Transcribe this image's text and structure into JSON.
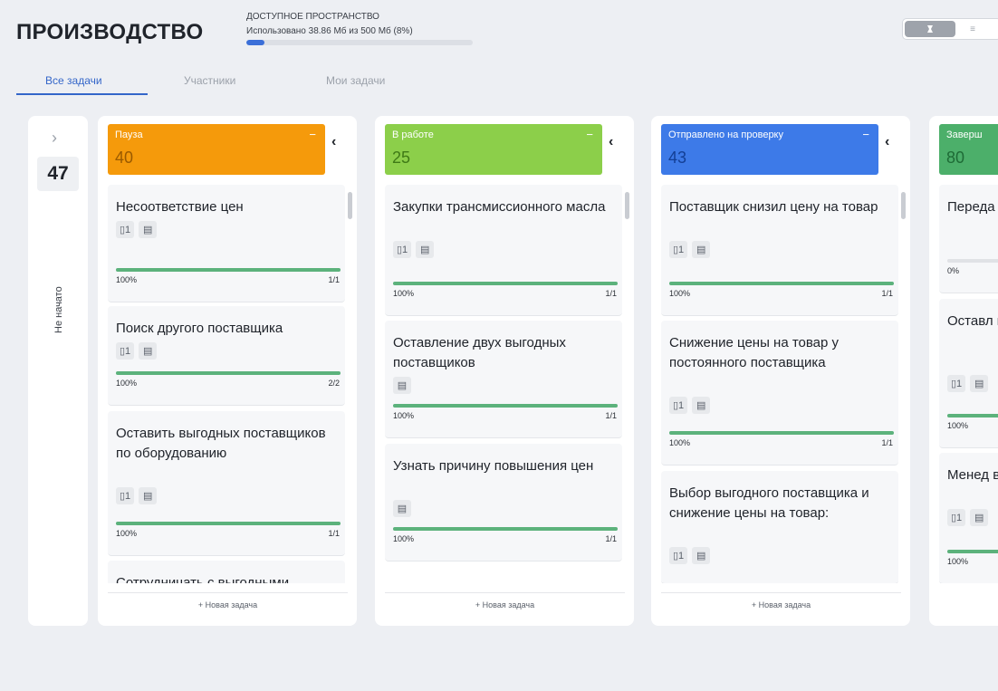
{
  "header": {
    "title": "ПРОИЗВОДСТВО",
    "space_label": "ДОСТУПНОЕ ПРОСТРАНСТВО",
    "space_used": "Использовано 38.86 Мб из 500 Мб (8%)",
    "space_fraction": 0.08,
    "view_toggle_active_icon": "board-icon",
    "view_toggle_inactive_icon": "list-icon",
    "view_toggle_inactive_glyph": "≡"
  },
  "tabs": [
    {
      "label": "Все задачи",
      "active": true
    },
    {
      "label": "Участники",
      "active": false
    },
    {
      "label": "Мои задачи",
      "active": false
    }
  ],
  "side": {
    "chevron": "›",
    "count": "47",
    "label": "Не начато"
  },
  "columns": [
    {
      "name": "Пауза",
      "count": "40",
      "color": "#f59a0b",
      "count_color": "#9a5a00",
      "dash": "−",
      "collapse": "‹",
      "new_task": "+ Новая задача",
      "cards": [
        {
          "title": "Несоответствие цен",
          "chips": [
            "▯1",
            "▤"
          ],
          "pct": "100%",
          "cnt": "1/1",
          "fill": 1.0
        },
        {
          "title": "Поиск другого поставщика",
          "chips": [
            "▯1",
            "▤"
          ],
          "pct": "100%",
          "cnt": "2/2",
          "fill": 1.0
        },
        {
          "title": "Оставить выгодных поставщиков по оборудованию",
          "chips": [
            "▯1",
            "▤"
          ],
          "pct": "100%",
          "cnt": "1/1",
          "fill": 1.0
        },
        {
          "title": "Сотрудничать с выгодными",
          "chips": [],
          "pct": "",
          "cnt": "",
          "fill": 1.0
        }
      ]
    },
    {
      "name": "В работе",
      "count": "25",
      "color": "#8ccf4a",
      "count_color": "#3f7a16",
      "dash": "−",
      "collapse": "‹",
      "new_task": "+ Новая задача",
      "cards": [
        {
          "title": "Закупки трансмиссионного масла",
          "chips": [
            "▯1",
            "▤"
          ],
          "pct": "100%",
          "cnt": "1/1",
          "fill": 1.0
        },
        {
          "title": "Оставление двух выгодных поставщиков",
          "chips": [
            "▤"
          ],
          "pct": "100%",
          "cnt": "1/1",
          "fill": 1.0
        },
        {
          "title": "Узнать причину повышения цен",
          "chips": [
            "▤"
          ],
          "pct": "100%",
          "cnt": "1/1",
          "fill": 1.0
        }
      ]
    },
    {
      "name": "Отправлено на проверку",
      "count": "43",
      "color": "#3d7ae8",
      "count_color": "#133f95",
      "dash": "−",
      "collapse": "‹",
      "new_task": "+ Новая задача",
      "cards": [
        {
          "title": "Поставщик снизил цену на товар",
          "chips": [
            "▯1",
            "▤"
          ],
          "pct": "100%",
          "cnt": "1/1",
          "fill": 1.0
        },
        {
          "title": "Снижение цены на товар у постоянного поставщика",
          "chips": [
            "▯1",
            "▤"
          ],
          "pct": "100%",
          "cnt": "1/1",
          "fill": 1.0
        },
        {
          "title": "Выбор выгодного поставщика и снижение цены на товар:",
          "chips": [
            "▯1",
            "▤"
          ],
          "pct": "",
          "cnt": "",
          "fill": 1.0
        }
      ]
    },
    {
      "name": "Заверш",
      "count": "80",
      "color": "#4caf6a",
      "count_color": "#1e6b36",
      "dash": "",
      "collapse": "",
      "new_task": "",
      "cards": [
        {
          "title": "Переда менедж",
          "chips": [],
          "pct": "0%",
          "cnt": "",
          "fill": 0.0
        },
        {
          "title": "Оставл постоя товар:",
          "chips": [
            "▯1",
            "▤"
          ],
          "pct": "100%",
          "cnt": "",
          "fill": 1.0
        },
        {
          "title": "Менед выгодн",
          "chips": [
            "▯1",
            "▤"
          ],
          "pct": "100%",
          "cnt": "",
          "fill": 1.0
        }
      ]
    }
  ]
}
